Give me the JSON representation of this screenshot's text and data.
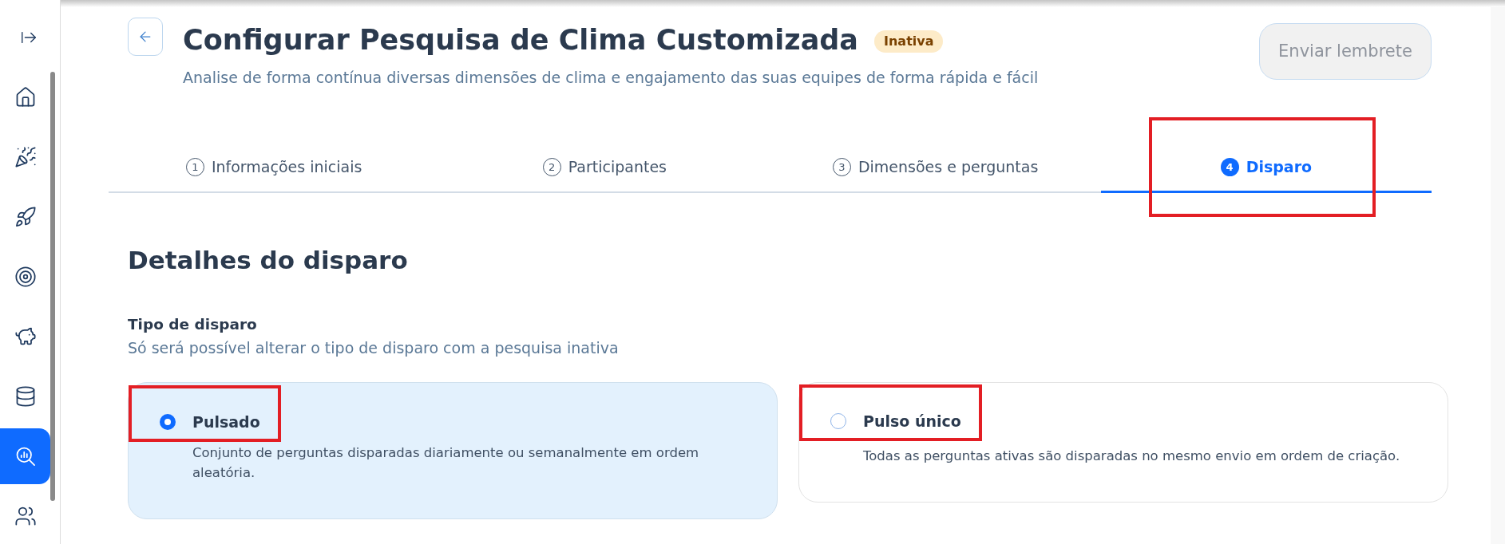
{
  "sidebar": {
    "items": [
      {
        "selected": false
      },
      {
        "selected": false
      },
      {
        "selected": false
      },
      {
        "selected": false
      },
      {
        "selected": false
      },
      {
        "selected": false
      },
      {
        "selected": true
      },
      {
        "selected": false
      }
    ]
  },
  "header": {
    "title": "Configurar Pesquisa de Clima Customizada",
    "status_badge": "Inativa",
    "subtitle": "Analise de forma contínua diversas dimensões de clima e engajamento das suas equipes de forma rápida e fácil",
    "reminder_button": {
      "label": "Enviar lembrete",
      "disabled": true
    }
  },
  "steps": [
    {
      "number": "1",
      "label": "Informações iniciais",
      "selected": false,
      "highlighted": false
    },
    {
      "number": "2",
      "label": "Participantes",
      "selected": false,
      "highlighted": false
    },
    {
      "number": "3",
      "label": "Dimensões e perguntas",
      "selected": false,
      "highlighted": false
    },
    {
      "number": "4",
      "label": "Disparo",
      "selected": true,
      "highlighted": true
    }
  ],
  "section": {
    "title": "Detalhes do disparo",
    "field_label": "Tipo de disparo",
    "hint": "Só será possível alterar o tipo de disparo com a pesquisa inativa",
    "options": [
      {
        "title": "Pulsado",
        "description": "Conjunto de perguntas disparadas diariamente ou semanalmente em ordem aleatória.",
        "selected": true,
        "highlighted": true
      },
      {
        "title": "Pulso único",
        "description": "Todas as perguntas ativas são disparadas no mesmo envio em ordem de criação.",
        "selected": false,
        "highlighted": true
      }
    ]
  }
}
